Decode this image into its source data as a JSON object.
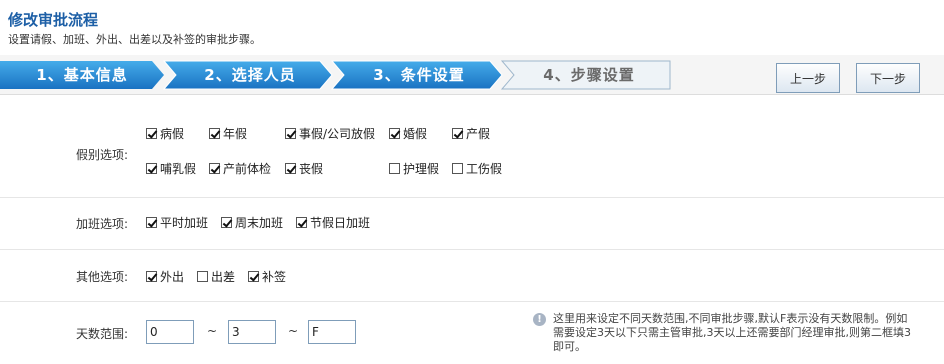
{
  "header": {
    "title": "修改审批流程",
    "subtitle": "设置请假、加班、外出、出差以及补签的审批步骤。"
  },
  "wizard": {
    "steps": [
      {
        "label": "1、基本信息"
      },
      {
        "label": "2、选择人员"
      },
      {
        "label": "3、条件设置"
      },
      {
        "label": "4、步骤设置"
      }
    ],
    "prev_label": "上一步",
    "next_label": "下一步"
  },
  "leave": {
    "label": "假别选项:",
    "options": [
      {
        "label": "病假",
        "checked": true
      },
      {
        "label": "年假",
        "checked": true
      },
      {
        "label": "事假/公司放假",
        "checked": true
      },
      {
        "label": "婚假",
        "checked": true
      },
      {
        "label": "产假",
        "checked": true
      },
      {
        "label": "哺乳假",
        "checked": true
      },
      {
        "label": "产前体检",
        "checked": true
      },
      {
        "label": "丧假",
        "checked": true
      },
      {
        "label": "护理假",
        "checked": false
      },
      {
        "label": "工伤假",
        "checked": false
      }
    ]
  },
  "overtime": {
    "label": "加班选项:",
    "options": [
      {
        "label": "平时加班",
        "checked": true
      },
      {
        "label": "周末加班",
        "checked": true
      },
      {
        "label": "节假日加班",
        "checked": true
      }
    ]
  },
  "other": {
    "label": "其他选项:",
    "options": [
      {
        "label": "外出",
        "checked": true
      },
      {
        "label": "出差",
        "checked": false
      },
      {
        "label": "补签",
        "checked": true
      }
    ]
  },
  "days": {
    "label": "天数范围:",
    "values": [
      "0",
      "3",
      "F"
    ],
    "separator": "~",
    "hint": "这里用来设定不同天数范围,不同审批步骤,默认F表示没有天数限制。例如需要设定3天以下只需主管审批,3天以上还需要部门经理审批,则第二框填3即可。"
  }
}
